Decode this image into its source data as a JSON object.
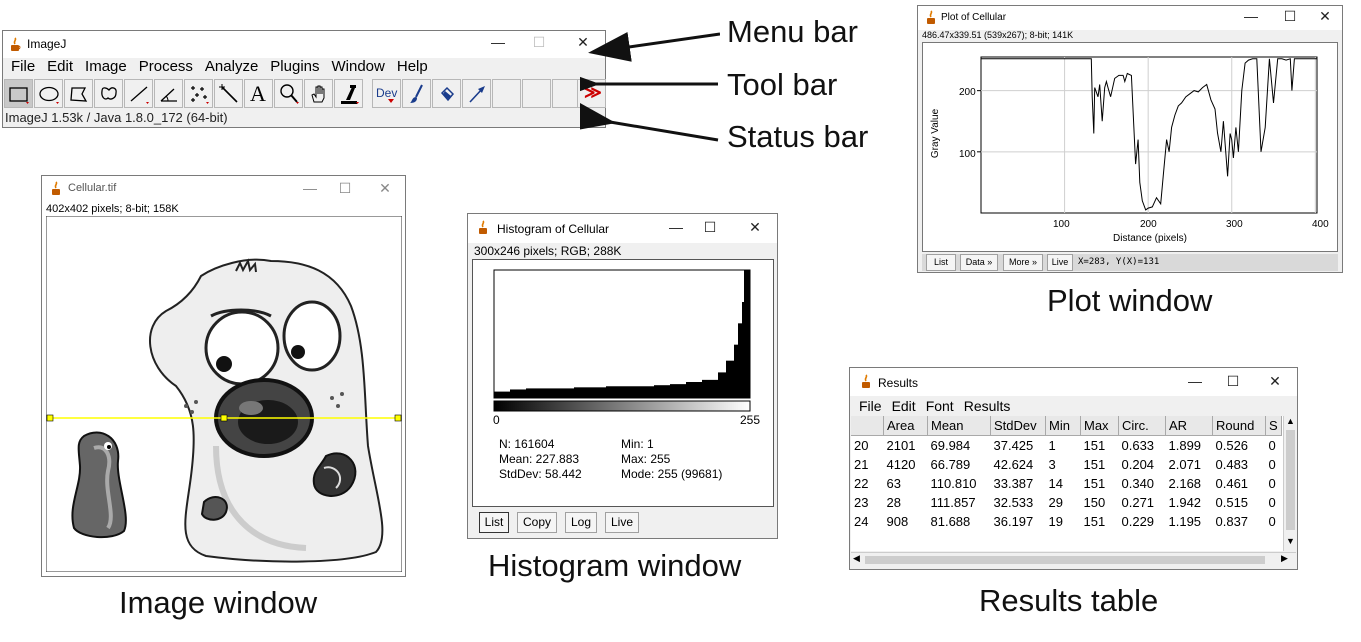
{
  "imagej": {
    "title": "ImageJ",
    "menu": [
      "File",
      "Edit",
      "Image",
      "Process",
      "Analyze",
      "Plugins",
      "Window",
      "Help"
    ],
    "status": "ImageJ 1.53k / Java 1.8.0_172 (64-bit)",
    "tools": [
      "rectangle",
      "oval",
      "polygon",
      "freehand",
      "straight-line",
      "angle",
      "multi-point",
      "wand",
      "text",
      "magnifier",
      "scrolling",
      "color-picker",
      "dev-menu",
      "brush",
      "flood-fill",
      "arrow",
      "blank",
      "blank",
      "blank",
      "more-tools"
    ],
    "dev_label": "Dev",
    "more_glyph": "≫",
    "text_glyph": "A"
  },
  "labels": {
    "menu_bar": "Menu bar",
    "tool_bar": "Tool bar",
    "status_bar": "Status bar",
    "image_window": "Image window",
    "histogram_window": "Histogram window",
    "plot_window": "Plot window",
    "results_table": "Results table"
  },
  "image_window": {
    "title": "Cellular.tif",
    "info": "402x402 pixels; 8-bit; 158K"
  },
  "histogram": {
    "title": "Histogram of Cellular",
    "info": "300x246 pixels; RGB; 288K",
    "x_min": "0",
    "x_max": "255",
    "stats_left": [
      "N: 161604",
      "Mean: 227.883",
      "StdDev: 58.442"
    ],
    "stats_right": [
      "Min: 1",
      "Max: 255",
      "Mode: 255 (99681)"
    ],
    "buttons": [
      "List",
      "Copy",
      "Log",
      "Live"
    ]
  },
  "plot": {
    "title": "Plot of Cellular",
    "info": "486.47x339.51  (539x267); 8-bit; 141K",
    "xlabel": "Distance (pixels)",
    "ylabel": "Gray Value",
    "x_ticks": [
      "100",
      "200",
      "300",
      "400"
    ],
    "y_ticks": [
      "100",
      "200"
    ],
    "buttons": [
      "List",
      "Data »",
      "More »",
      "Live"
    ],
    "coords": "X=283, Y(X)=131"
  },
  "results": {
    "title": "Results",
    "menu": [
      "File",
      "Edit",
      "Font",
      "Results"
    ],
    "columns": [
      "",
      "Area",
      "Mean",
      "StdDev",
      "Min",
      "Max",
      "Circ.",
      "AR",
      "Round",
      "S"
    ],
    "rows": [
      [
        "20",
        "2101",
        "69.984",
        "37.425",
        "1",
        "151",
        "0.633",
        "1.899",
        "0.526",
        "0"
      ],
      [
        "21",
        "4120",
        "66.789",
        "42.624",
        "3",
        "151",
        "0.204",
        "2.071",
        "0.483",
        "0"
      ],
      [
        "22",
        "63",
        "110.810",
        "33.387",
        "14",
        "151",
        "0.340",
        "2.168",
        "0.461",
        "0"
      ],
      [
        "23",
        "28",
        "111.857",
        "32.533",
        "29",
        "150",
        "0.271",
        "1.942",
        "0.515",
        "0"
      ],
      [
        "24",
        "908",
        "81.688",
        "36.197",
        "19",
        "151",
        "0.229",
        "1.195",
        "0.837",
        "0"
      ]
    ]
  },
  "chart_data": [
    {
      "type": "line",
      "xlabel": "Distance (pixels)",
      "ylabel": "Gray Value",
      "xlim": [
        0,
        402
      ],
      "ylim": [
        0,
        255
      ],
      "x": [
        0,
        20,
        60,
        100,
        132,
        133,
        135,
        136,
        140,
        142,
        145,
        148,
        150,
        152,
        155,
        160,
        165,
        170,
        172,
        175,
        180,
        185,
        188,
        190,
        193,
        197,
        200,
        205,
        210,
        215,
        218,
        222,
        225,
        228,
        232,
        236,
        240,
        245,
        250,
        255,
        260,
        265,
        270,
        275,
        280,
        283,
        287,
        290,
        295,
        298,
        300,
        302,
        305,
        308,
        312,
        316,
        320,
        325,
        330,
        335,
        340,
        345,
        350,
        355,
        360,
        365,
        370,
        372,
        375,
        378,
        380,
        385,
        390,
        395,
        402
      ],
      "y": [
        252,
        252,
        252,
        252,
        252,
        190,
        130,
        205,
        190,
        210,
        150,
        205,
        215,
        205,
        190,
        220,
        225,
        225,
        215,
        228,
        225,
        80,
        120,
        50,
        20,
        5,
        8,
        10,
        25,
        15,
        60,
        120,
        100,
        140,
        160,
        175,
        180,
        190,
        195,
        200,
        198,
        205,
        210,
        185,
        170,
        131,
        100,
        150,
        60,
        130,
        120,
        90,
        140,
        100,
        200,
        245,
        250,
        252,
        252,
        100,
        140,
        252,
        180,
        252,
        252,
        250,
        252,
        200,
        252,
        252,
        252,
        252,
        252,
        252,
        252
      ]
    },
    {
      "type": "bar",
      "xlabel": "",
      "ylabel": "",
      "xlim": [
        0,
        255
      ],
      "bins": [
        0,
        16,
        32,
        48,
        64,
        80,
        96,
        112,
        128,
        144,
        160,
        176,
        192,
        208,
        224,
        232,
        240,
        244,
        248,
        250,
        252,
        254,
        255
      ],
      "counts": [
        600,
        800,
        900,
        900,
        900,
        1000,
        1000,
        1100,
        1100,
        1100,
        1200,
        1300,
        1500,
        1700,
        2400,
        3500,
        5000,
        7000,
        9000,
        12000,
        20000,
        40000,
        99681
      ]
    }
  ]
}
